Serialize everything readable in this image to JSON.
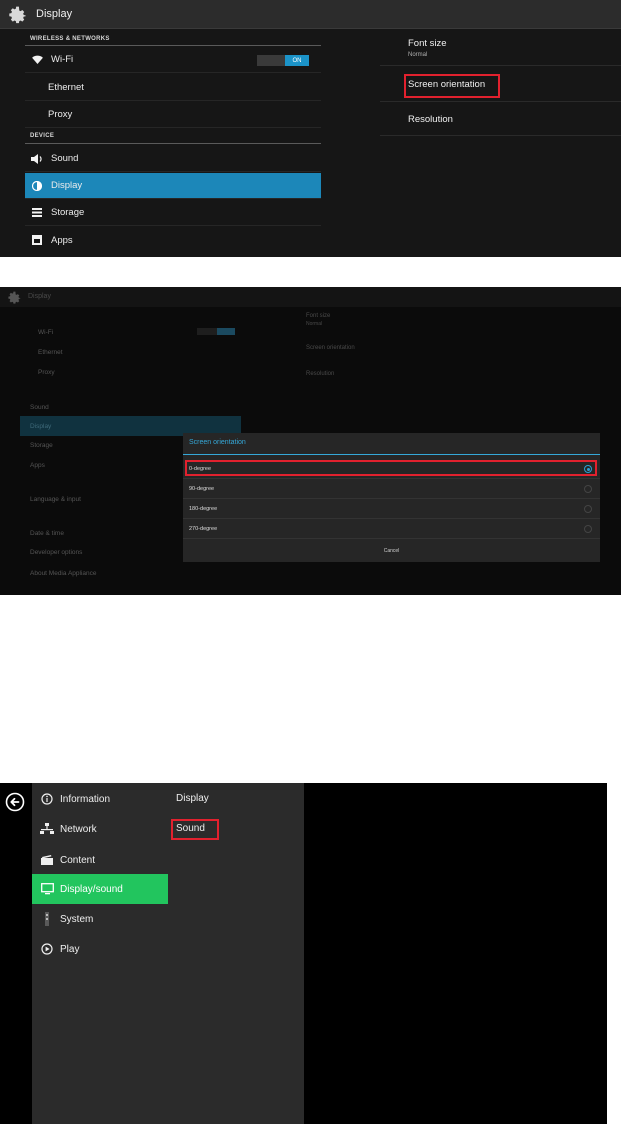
{
  "panel1": {
    "title": "Display",
    "categories": {
      "wireless": "WIRELESS & NETWORKS",
      "device": "DEVICE"
    },
    "wifi": {
      "label": "Wi-Fi",
      "toggle": "ON"
    },
    "items": {
      "ethernet": "Ethernet",
      "proxy": "Proxy",
      "sound": "Sound",
      "display": "Display",
      "storage": "Storage",
      "apps": "Apps"
    },
    "right": {
      "font_size": {
        "title": "Font size",
        "summary": "Normal"
      },
      "screen_orientation": "Screen orientation",
      "resolution": "Resolution"
    },
    "colors": {
      "selected": "#1c87b9",
      "highlight": "#e2212e",
      "toggle_on": "#1b93c8"
    }
  },
  "panel2": {
    "dialog": {
      "title": "Screen orientation",
      "options": [
        "0-degree",
        "90-degree",
        "180-degree",
        "270-degree"
      ],
      "selected": "0-degree",
      "cancel": "Cancel"
    },
    "background_labels": [
      "Wi-Fi",
      "Ethernet",
      "Proxy",
      "Sound",
      "Display",
      "Storage",
      "Apps",
      "Language & input",
      "Date & time",
      "Developer options",
      "About Media Appliance",
      "Font size",
      "Normal",
      "Screen orientation",
      "Resolution"
    ],
    "colors": {
      "accent": "#35a8d8",
      "highlight": "#e2212e"
    }
  },
  "panel3": {
    "nav": [
      "Information",
      "Network",
      "Content",
      "Display/sound",
      "System",
      "Play"
    ],
    "selected": "Display/sound",
    "sub": [
      "Display",
      "Sound"
    ],
    "highlighted_sub": "Sound",
    "colors": {
      "selected": "#22c55e",
      "highlight": "#e2212e"
    }
  }
}
